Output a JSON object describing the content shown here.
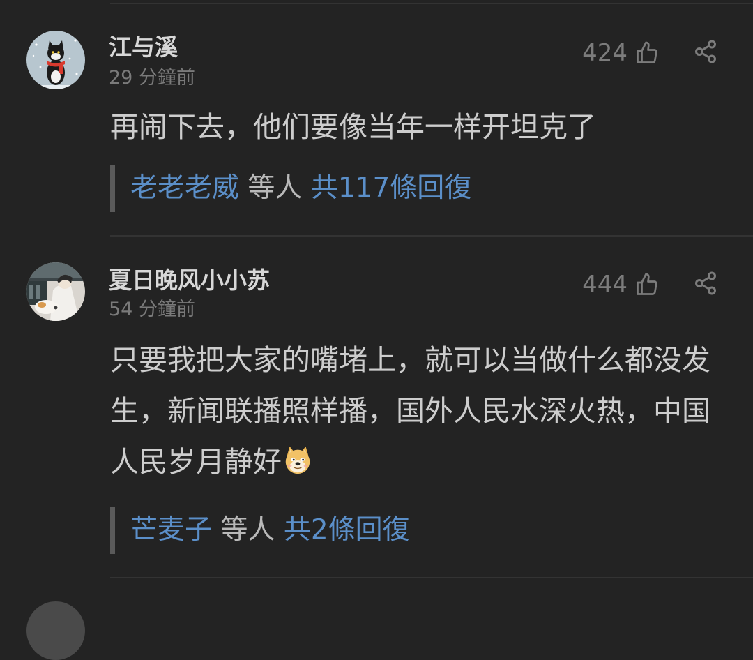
{
  "comments": [
    {
      "username": "江与溪",
      "time": "29 分鐘前",
      "likes": "424",
      "text": "再闹下去，他们要像当年一样开坦克了",
      "reply_name": "老老老威",
      "reply_mid": " 等人 ",
      "reply_count": "共117條回復",
      "avatar_icon": "cat-avatar"
    },
    {
      "username": "夏日晚风小小苏",
      "time": "54 分鐘前",
      "likes": "444",
      "text": "只要我把大家的嘴堵上，就可以当做什么都没发生，新闻联播照样播，国外人民水深火热，中国人民岁月静好",
      "emoji": "doge-emoji",
      "reply_name": "芒麦子",
      "reply_mid": " 等人 ",
      "reply_count": "共2條回復",
      "avatar_icon": "person-with-cat-avatar"
    }
  ],
  "colors": {
    "background": "#232323",
    "username": "#d8d8d8",
    "text": "#cdcdcd",
    "meta": "#7a7a7a",
    "link": "#5b8fc9"
  }
}
